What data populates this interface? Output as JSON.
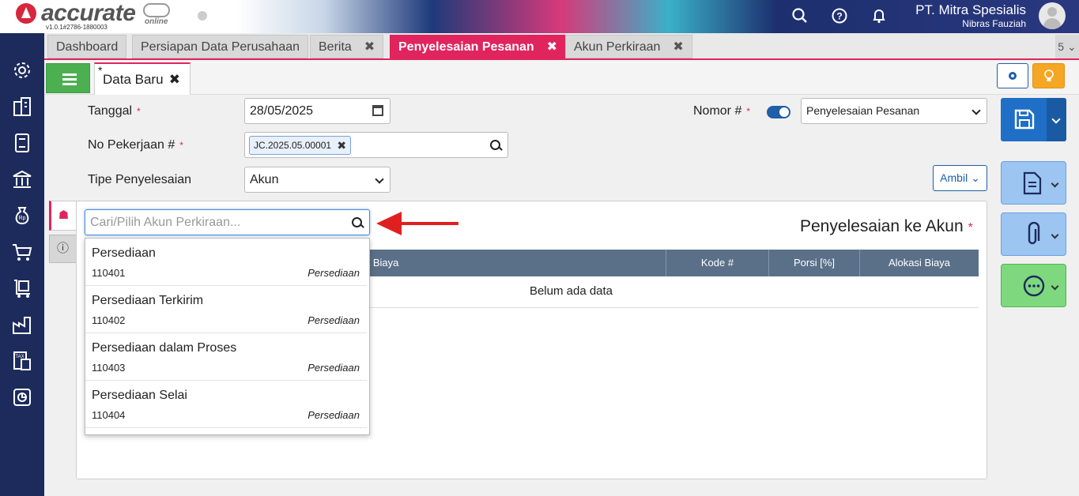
{
  "header": {
    "brand": "accurate",
    "brand_sub": "online",
    "version": "v1.0.1#2786-1880003",
    "company": "PT. Mitra Spesialis",
    "user": "Nibras Fauziah"
  },
  "tabs": [
    {
      "label": "Dashboard",
      "closable": false
    },
    {
      "label": "Persiapan Data Perusahaan",
      "closable": false
    },
    {
      "label": "Berita",
      "closable": true
    },
    {
      "label": "Penyelesaian Pesanan",
      "closable": true,
      "active": true
    },
    {
      "label": "Akun Perkiraan",
      "closable": true
    }
  ],
  "tab_count": "5",
  "close_glyph": "✖",
  "doc_tab": {
    "star": "*",
    "label": "Data Baru"
  },
  "form": {
    "tanggal_label": "Tanggal",
    "tanggal_value": "28/05/2025",
    "no_pekerjaan_label": "No Pekerjaan #",
    "no_pekerjaan_chip": "JC.2025.05.00001",
    "tipe_label": "Tipe Penyelesaian",
    "tipe_value": "Akun",
    "nomor_label": "Nomor #",
    "nomor_value": "Penyelesaian Pesanan",
    "ambil_label": "Ambil",
    "required_mark": "*"
  },
  "panel": {
    "title": "Penyelesaian ke Akun",
    "search_placeholder": "Cari/Pilih Akun Perkiraan...",
    "columns": [
      "a Biaya",
      "Kode #",
      "Porsi [%]",
      "Alokasi Biaya"
    ],
    "empty_text": "Belum ada data"
  },
  "dropdown": [
    {
      "name": "Persediaan",
      "code": "110401",
      "type": "Persediaan"
    },
    {
      "name": "Persediaan Terkirim",
      "code": "110402",
      "type": "Persediaan"
    },
    {
      "name": "Persediaan dalam Proses",
      "code": "110403",
      "type": "Persediaan"
    },
    {
      "name": "Persediaan Selai",
      "code": "110404",
      "type": "Persediaan"
    }
  ],
  "colors": {
    "accent": "#e0245e",
    "primary": "#1f6fc7",
    "sidebar": "#1d2b5c",
    "table_header": "#5a7089"
  },
  "sidebar_icons": [
    "gear-icon",
    "building-icon",
    "book-icon",
    "bank-icon",
    "money-bag-icon",
    "cart-icon",
    "trolley-box-icon",
    "factory-icon",
    "tax-icon",
    "report-icon"
  ]
}
